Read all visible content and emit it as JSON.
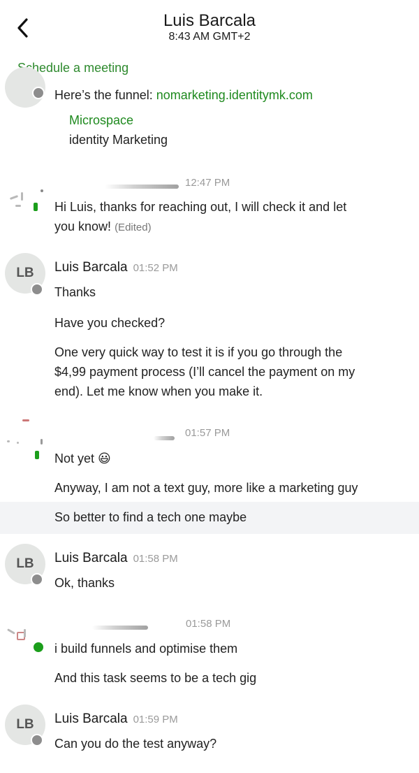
{
  "header": {
    "title": "Luis Barcala",
    "subtitle": "8:43 AM GMT+2",
    "schedule_link": "Schedule a meeting"
  },
  "messages": {
    "m1": {
      "line_prefix": "Here’s the funnel: ",
      "link": "nomarketing.identitymk.com",
      "preview_title": "Microspace",
      "preview_subtitle": "identity Marketing"
    },
    "m2": {
      "sender_partial": "…y…uv",
      "time": "12:47 PM",
      "line1": "Hi Luis, thanks for reaching out, I will check it and let",
      "line2": "you know!",
      "edited": "(Edited)"
    },
    "m3": {
      "avatar": "LB",
      "sender": "Luis Barcala",
      "time": "01:52 PM",
      "text1": "Thanks",
      "text2": "Have you checked?",
      "text3_line1": "One very quick way to test it is if you go through the",
      "text3_line2": "$4,99 payment process (I’ll cancel the payment on my",
      "text3_line3": "end). Let me know when you make it."
    },
    "m4": {
      "sender_partial": ".uv",
      "time": "01:57 PM",
      "text1": "Not yet",
      "text1_emoji": "😃",
      "text2": "Anyway, I am not a text guy, more like a marketing guy",
      "text3": "So better to find a tech one maybe"
    },
    "m5": {
      "avatar": "LB",
      "sender": "Luis Barcala",
      "time": "01:58 PM",
      "text1": "Ok, thanks"
    },
    "m6": {
      "time": "01:58 PM",
      "text1": "i build funnels and optimise them",
      "text2": "And this task seems to be a tech gig"
    },
    "m7": {
      "avatar": "LB",
      "sender": "Luis Barcala",
      "time": "01:59 PM",
      "text1": "Can you do the test anyway?"
    }
  },
  "colors": {
    "accent_green": "#1f8a1f",
    "presence_online": "#1b9e1b",
    "presence_away": "#8d8d8d"
  }
}
